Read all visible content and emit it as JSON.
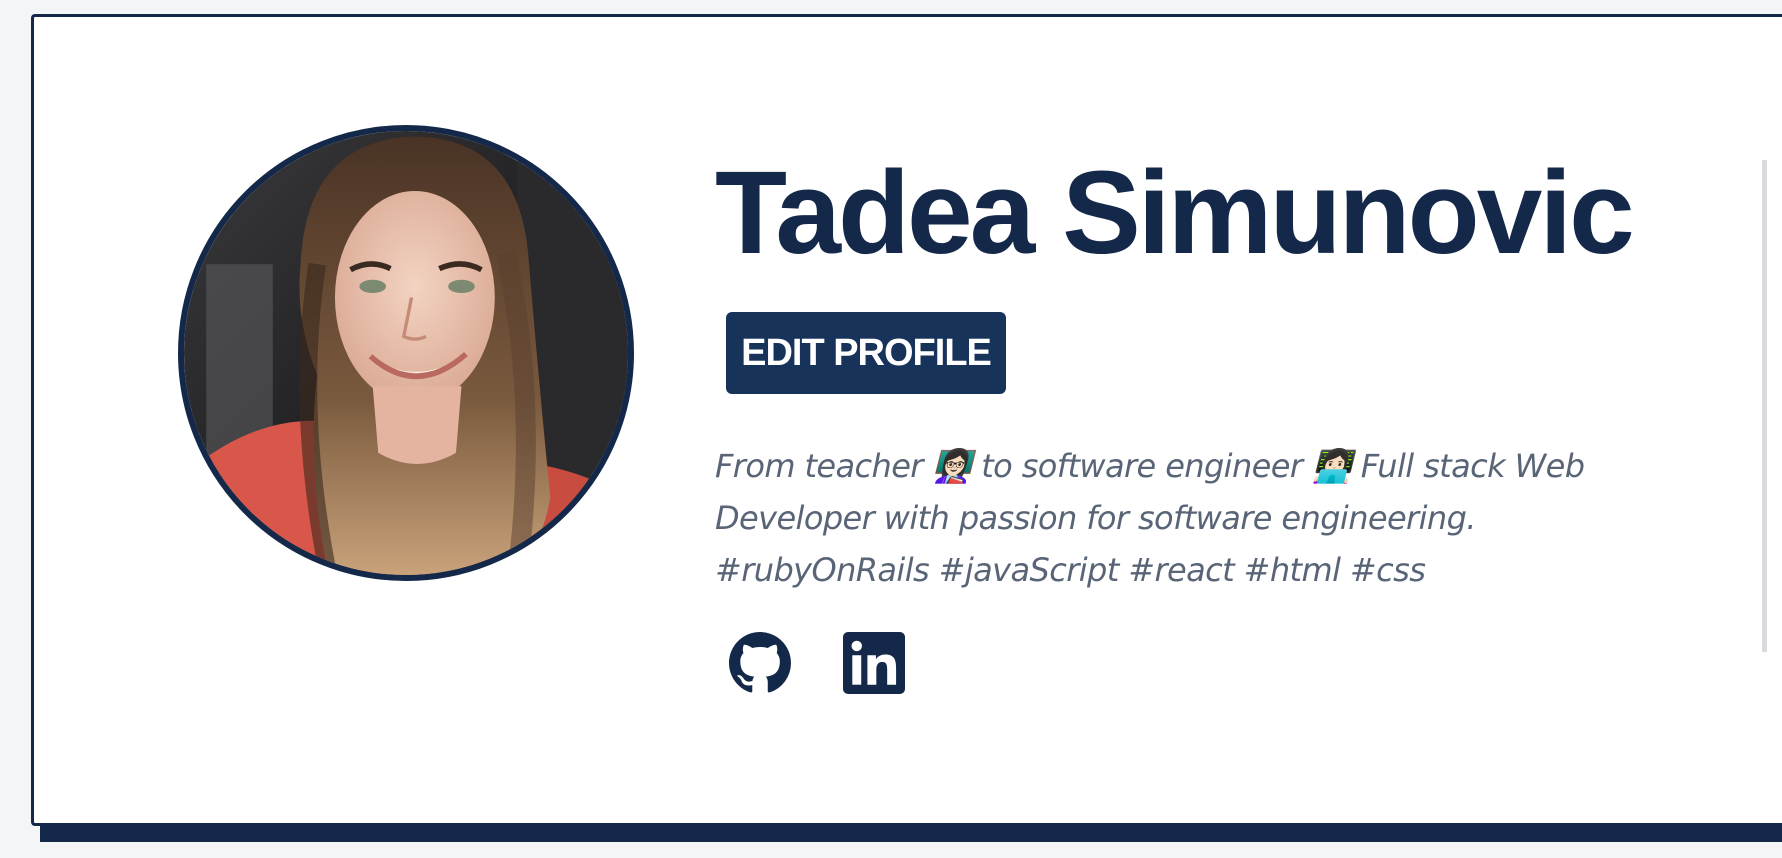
{
  "profile": {
    "name": "Tadea Simunovic",
    "edit_button_label": "EDIT PROFILE",
    "bio": "From teacher 👩🏻‍🏫  to software engineer 👩🏻‍💻  Full stack Web Developer with passion for software engineering. #rubyOnRails #javaScript #react #html #css",
    "avatar_alt": "Tadea Simunovic"
  },
  "social_links": [
    {
      "icon": "github-icon",
      "label": "GitHub"
    },
    {
      "icon": "linkedin-icon",
      "label": "LinkedIn"
    }
  ],
  "colors": {
    "primary": "#14294a",
    "button": "#17335a",
    "bio_text": "#596577",
    "background": "#f3f5f6",
    "card": "#ffffff"
  }
}
